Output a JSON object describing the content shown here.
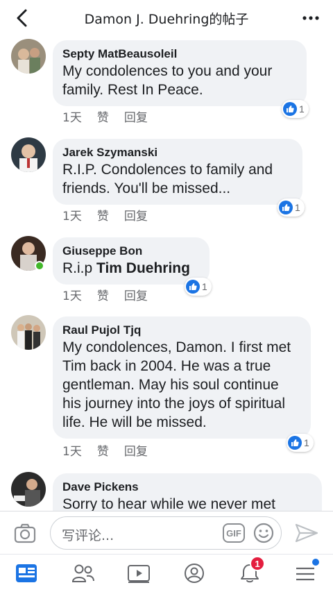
{
  "header": {
    "title": "Damon J. Duehring的帖子"
  },
  "comments": [
    {
      "name": "Septy MatBeausoleil",
      "text": "My condolences to you and your family. Rest In Peace.",
      "time": "1天",
      "like": "赞",
      "reply": "回复",
      "reactions": "1"
    },
    {
      "name": "Jarek Szymanski",
      "text": "R.I.P. Condolences to family and friends. You'll be missed...",
      "time": "1天",
      "like": "赞",
      "reply": "回复",
      "reactions": "1"
    },
    {
      "name": "Giuseppe Bon",
      "text_prefix": "R.i.p ",
      "text_tag": "Tim Duehring",
      "time": "1天",
      "like": "赞",
      "reply": "回复",
      "reactions": "1"
    },
    {
      "name": "Raul Pujol Tjq",
      "text": "My condolences, Damon. I first met Tim back in 2004. He was a true gentleman. May his soul continue his journey into the joys of spiritual life. He will be missed.",
      "time": "1天",
      "like": "赞",
      "reply": "回复",
      "reactions": "1"
    },
    {
      "name": "Dave Pickens",
      "text": "Sorry to hear while we never met"
    }
  ],
  "composer": {
    "placeholder": "写评论...",
    "gif_label": "GIF"
  },
  "tabbar": {
    "notifications_badge": "1"
  },
  "colors": {
    "accent": "#1b74e4",
    "bubble": "#f0f2f5",
    "online": "#42b72a",
    "badge": "#e41e3f"
  }
}
